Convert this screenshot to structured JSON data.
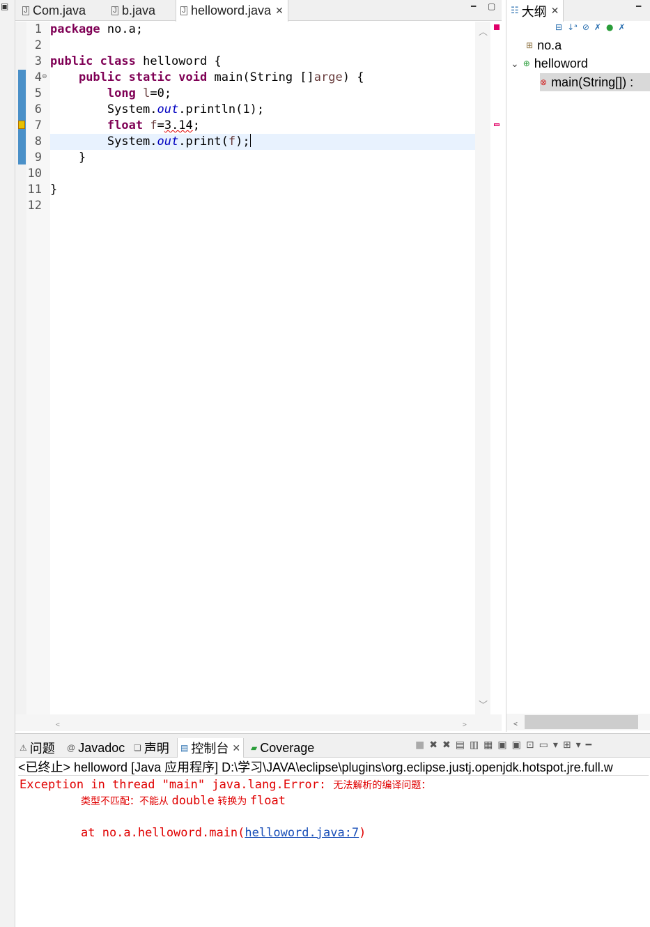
{
  "editor": {
    "tabs": [
      {
        "label": "Com.java",
        "active": false
      },
      {
        "label": "b.java",
        "active": false
      },
      {
        "label": "helloword.java",
        "active": true
      }
    ],
    "lines": [
      {
        "num": "1",
        "text": "package no.a;"
      },
      {
        "num": "2",
        "text": ""
      },
      {
        "num": "3",
        "text": "public class helloword {"
      },
      {
        "num": "4",
        "text": "    public static void main(String []arge) {"
      },
      {
        "num": "5",
        "text": "        long l=0;"
      },
      {
        "num": "6",
        "text": "        System.out.println(1);"
      },
      {
        "num": "7",
        "text": "        float f=3.14;"
      },
      {
        "num": "8",
        "text": "        System.out.print(f);"
      },
      {
        "num": "9",
        "text": "    }"
      },
      {
        "num": "10",
        "text": ""
      },
      {
        "num": "11",
        "text": "}"
      },
      {
        "num": "12",
        "text": ""
      }
    ]
  },
  "outline": {
    "title": "大纲",
    "items": [
      {
        "label": "no.a",
        "icon": "package-icon"
      },
      {
        "label": "helloword",
        "icon": "class-icon"
      },
      {
        "label": "main(String[]) :",
        "icon": "method-error-icon"
      }
    ]
  },
  "console": {
    "tabs": [
      {
        "label": "问题",
        "icon": "problems-icon"
      },
      {
        "label": "Javadoc",
        "icon": "javadoc-icon"
      },
      {
        "label": "声明",
        "icon": "declaration-icon"
      },
      {
        "label": "控制台",
        "icon": "console-icon",
        "active": true
      },
      {
        "label": "Coverage",
        "icon": "coverage-icon"
      }
    ],
    "status": "<已终止> helloword [Java 应用程序] D:\\学习\\JAVA\\eclipse\\plugins\\org.eclipse.justj.openjdk.hotspot.jre.full.w",
    "output": {
      "line1_prefix": "Exception in thread \"main\" java.lang.Error: ",
      "line1_cjk": "无法解析的编译问题：",
      "line2_cjk_a": "类型不匹配：不能从 ",
      "line2_type_a": "double",
      "line2_cjk_b": " 转换为 ",
      "line2_type_b": "float",
      "line3_prefix": "at no.a.helloword.main(",
      "line3_link": "helloword.java:7",
      "line3_suffix": ")"
    }
  },
  "colors": {
    "keyword": "#7f0055",
    "field": "#0000c0",
    "error_text": "#e00000",
    "current_line": "#e8f2fe",
    "link": "#1a4fb8"
  }
}
